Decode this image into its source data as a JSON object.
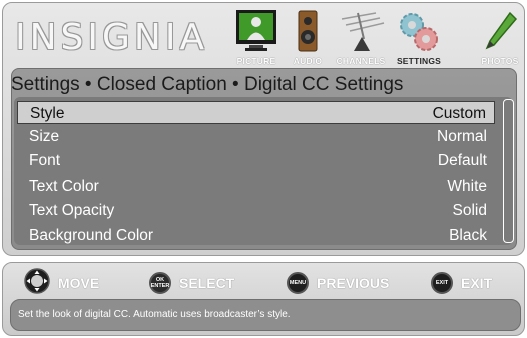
{
  "brand": {
    "logo_text": "INSIGNIA"
  },
  "menu_tabs": [
    {
      "label": "PICTURE",
      "icon": "tv-picture-icon",
      "active": false
    },
    {
      "label": "AUDIO",
      "icon": "speaker-icon",
      "active": false
    },
    {
      "label": "CHANNELS",
      "icon": "antenna-icon",
      "active": false
    },
    {
      "label": "SETTINGS",
      "icon": "gears-icon",
      "active": true
    },
    {
      "label": "PHOTOS",
      "icon": "pencil-icon",
      "active": false
    }
  ],
  "breadcrumb": "Settings • Closed Caption • Digital CC Settings",
  "settings": [
    {
      "label": "Style",
      "value": "Custom",
      "selected": true
    },
    {
      "label": "Size",
      "value": "Normal"
    },
    {
      "label": "Font",
      "value": "Default"
    },
    {
      "label": "Text Color",
      "value": "White"
    },
    {
      "label": "Text Opacity",
      "value": "Solid"
    },
    {
      "label": "Background Color",
      "value": "Black"
    }
  ],
  "hints": {
    "move": {
      "label": "MOVE"
    },
    "select": {
      "label": "SELECT",
      "button": "OK ENTER"
    },
    "previous": {
      "label": "PREVIOUS",
      "button": "MENU"
    },
    "exit": {
      "label": "EXIT",
      "button": "EXIT"
    }
  },
  "description": "Set the look of digital CC. Automatic uses broadcaster’s style.",
  "colors": {
    "panel": "#d9d9d9",
    "list_bg": "#7b7b7b",
    "selected_row": "#cfcfcf",
    "text_light": "#ffffff"
  }
}
